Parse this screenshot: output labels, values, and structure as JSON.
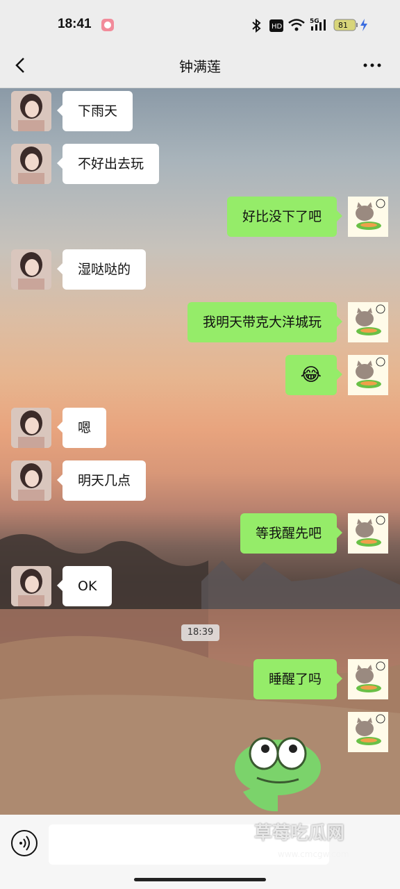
{
  "status": {
    "time": "18:41",
    "battery": "81",
    "network": "5G",
    "icons": [
      "app-icon",
      "bluetooth-icon",
      "hd-icon",
      "wifi-icon",
      "cell-signal-icon",
      "battery-icon",
      "charging-icon"
    ]
  },
  "header": {
    "title": "钟满莲",
    "back_icon": "chevron-left-icon",
    "more_icon": "more-horizontal-icon"
  },
  "messages": [
    {
      "side": "left",
      "text": "下雨天"
    },
    {
      "side": "left",
      "text": "不好出去玩"
    },
    {
      "side": "right",
      "text": "好比没下了吧"
    },
    {
      "side": "left",
      "text": "湿哒哒的"
    },
    {
      "side": "right",
      "text": "我明天带克大洋城玩"
    },
    {
      "side": "right",
      "text": "😂"
    },
    {
      "side": "left",
      "text": "嗯"
    },
    {
      "side": "left",
      "text": "明天几点"
    },
    {
      "side": "right",
      "text": "等我醒先吧"
    },
    {
      "side": "left",
      "text": "OK"
    },
    {
      "side": "right",
      "text": "睡醒了吗"
    },
    {
      "side": "right",
      "text": ""
    }
  ],
  "timestamp": "18:39",
  "input": {
    "placeholder": ""
  },
  "watermark": {
    "title": "草莓吃瓜网",
    "url": "www.cmcgw.com"
  },
  "colors": {
    "green_bubble": "#95ec69",
    "white_bubble": "#ffffff",
    "bar": "#ededed"
  }
}
